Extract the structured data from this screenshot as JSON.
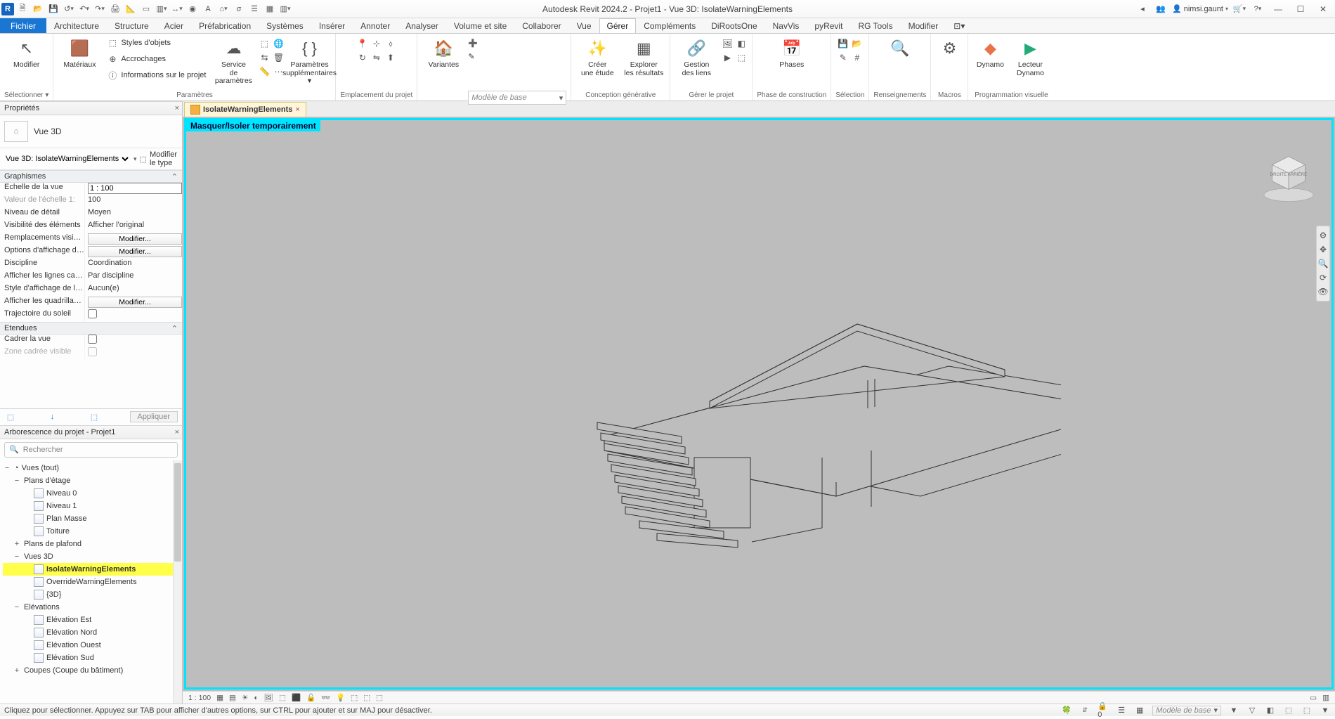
{
  "title": "Autodesk Revit 2024.2 - Projet1 - Vue 3D: IsolateWarningElements",
  "user": "nimsi.gaunt",
  "search_placeholder": "Rechercher",
  "tabs": {
    "file": "Fichier",
    "list": [
      "Architecture",
      "Structure",
      "Acier",
      "Préfabrication",
      "Systèmes",
      "Insérer",
      "Annoter",
      "Analyser",
      "Volume et site",
      "Collaborer",
      "Vue",
      "Gérer",
      "Compléments",
      "DiRootsOne",
      "NavVis",
      "pyRevit",
      "RG Tools",
      "Modifier"
    ],
    "active": "Gérer"
  },
  "ribbon": {
    "select_group": "Sélectionner",
    "modify": "Modifier",
    "materials": "Matériaux",
    "styles": "Styles d'objets",
    "snaps": "Accrochages",
    "project_info": "Informations sur le projet",
    "param_service": "Service\nde paramètres",
    "extra_params": "Paramètres\nsupplémentaires",
    "parameters_group": "Paramètres",
    "project_loc_group": "Emplacement du projet",
    "variants": "Variantes",
    "variants_group": "Variantes",
    "variant_placeholder": "Modèle de base",
    "create_study": "Créer\nune étude",
    "explore_results": "Explorer\nles résultats",
    "gen_design_group": "Conception générative",
    "manage_links": "Gestion\ndes liens",
    "manage_project_group": "Gérer le projet",
    "phases": "Phases",
    "phase_group": "Phase de construction",
    "selection_group": "Sélection",
    "inquiry_group": "Renseignements",
    "macros_group": "Macros",
    "dynamo": "Dynamo",
    "dynamo_player": "Lecteur\nDynamo",
    "visual_prog_group": "Programmation visuelle"
  },
  "properties": {
    "title": "Propriétés",
    "type_name": "Vue 3D",
    "instance_label": "Vue 3D: IsolateWarningElements",
    "edit_type": "Modifier le type",
    "cat_graphics": "Graphismes",
    "rows": {
      "scale_label": "Echelle de la vue",
      "scale_val": "1 : 100",
      "scaleval_label": "Valeur de l'échelle    1:",
      "scaleval_val": "100",
      "detail_label": "Niveau de détail",
      "detail_val": "Moyen",
      "visibility_label": "Visibilité des éléments",
      "visibility_val": "Afficher l'original",
      "override_label": "Remplacements visibili...",
      "override_btn": "Modifier...",
      "dispopt_label": "Options d'affichage des...",
      "dispopt_btn": "Modifier...",
      "discipline_label": "Discipline",
      "discipline_val": "Coordination",
      "hidden_label": "Afficher les lignes cach...",
      "hidden_val": "Par discipline",
      "analytic_label": "Style d'affichage de l'an...",
      "analytic_val": "Aucun(e)",
      "grid_label": "Afficher les quadrillages",
      "grid_btn": "Modifier...",
      "sun_label": "Trajectoire du soleil"
    },
    "cat_extents": "Etendues",
    "crop_label": "Cadrer la vue",
    "cropvis_label": "Zone cadrée visible",
    "apply": "Appliquer"
  },
  "browser": {
    "title": "Arborescence du projet - Projet1",
    "views_all": "Vues (tout)",
    "floor_plans": "Plans d'étage",
    "level0": "Niveau 0",
    "level1": "Niveau 1",
    "mass": "Plan Masse",
    "roof": "Toiture",
    "ceiling_plans": "Plans de plafond",
    "views3d": "Vues 3D",
    "isolate": "IsolateWarningElements",
    "override": "OverrideWarningElements",
    "default3d": "{3D}",
    "elevations": "Elévations",
    "elev_e": "Elévation Est",
    "elev_n": "Elévation Nord",
    "elev_o": "Elévation Ouest",
    "elev_s": "Elévation Sud",
    "sections": "Coupes (Coupe du bâtiment)"
  },
  "view": {
    "tab_name": "IsolateWarningElements",
    "temp_badge": "Masquer/Isoler temporairement",
    "cube_face": "DROITE ARRIÈRE",
    "scale": "1 : 100"
  },
  "status": {
    "msg": "Cliquez pour sélectionner. Appuyez sur TAB pour afficher d'autres options, sur CTRL pour ajouter et sur MAJ pour désactiver.",
    "variant": "Modèle de base"
  }
}
